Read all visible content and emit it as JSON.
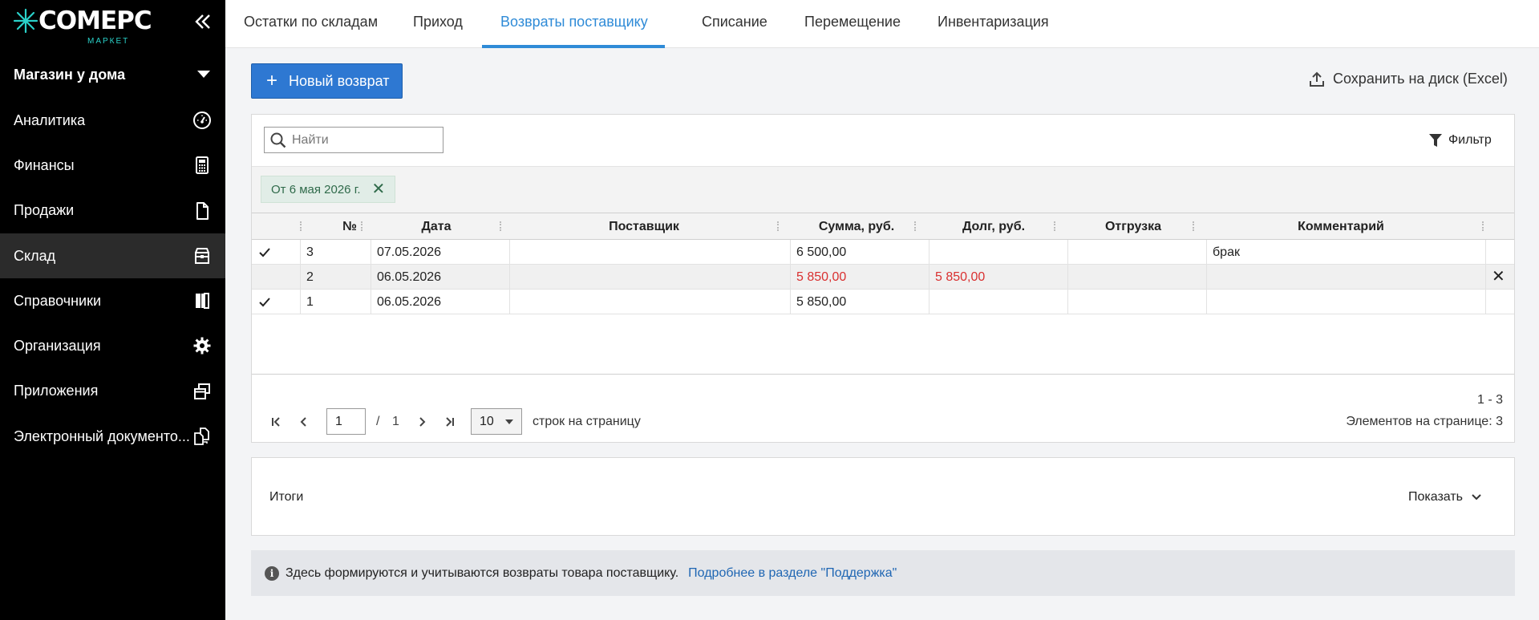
{
  "app": {
    "logo_text": "COMEPC",
    "logo_sub": "МАРКЕТ",
    "store_name": "Магазин у дома"
  },
  "sidebar": {
    "items": [
      {
        "label": "Аналитика",
        "icon": "dashboard-gauge-icon"
      },
      {
        "label": "Финансы",
        "icon": "calculator-icon"
      },
      {
        "label": "Продажи",
        "icon": "document-icon"
      },
      {
        "label": "Склад",
        "icon": "warehouse-box-icon",
        "active": true
      },
      {
        "label": "Справочники",
        "icon": "books-icon"
      },
      {
        "label": "Организация",
        "icon": "gear-icon"
      },
      {
        "label": "Приложения",
        "icon": "windows-icon"
      },
      {
        "label": "Электронный документо...",
        "icon": "doc-exchange-icon"
      }
    ]
  },
  "tabs": [
    {
      "label": "Остатки по складам"
    },
    {
      "label": "Приход"
    },
    {
      "label": "Возвраты поставщику",
      "active": true
    },
    {
      "label": "Списание"
    },
    {
      "label": "Перемещение"
    },
    {
      "label": "Инвентаризация"
    }
  ],
  "toolbar": {
    "new_label": "Новый возврат",
    "save_label": "Сохранить на диск (Excel)"
  },
  "grid": {
    "search_placeholder": "Найти",
    "filter_label": "Фильтр",
    "chip_label": "От 6 мая 2026 г.",
    "columns": [
      "№",
      "Дата",
      "Поставщик",
      "Сумма, руб.",
      "Долг, руб.",
      "Отгрузка",
      "Комментарий"
    ],
    "rows": [
      {
        "checked": true,
        "num": "3",
        "date": "07.05.2026",
        "supplier": "",
        "sum": "6 500,00",
        "debt": "",
        "shipment": "",
        "comment": "брак",
        "red": false
      },
      {
        "checked": false,
        "num": "2",
        "date": "06.05.2026",
        "supplier": "",
        "sum": "5 850,00",
        "debt": "5 850,00",
        "shipment": "",
        "comment": "",
        "red": true
      },
      {
        "checked": true,
        "num": "1",
        "date": "06.05.2026",
        "supplier": "",
        "sum": "5 850,00",
        "debt": "",
        "shipment": "",
        "comment": "",
        "red": false
      }
    ]
  },
  "pager": {
    "page": "1",
    "slash": "/",
    "total_pages": "1",
    "page_size": "10",
    "rows_label": "строк на страницу",
    "range": "1 - 3",
    "count_label": "Элементов на странице: 3"
  },
  "totals": {
    "label": "Итоги",
    "show_label": "Показать"
  },
  "info": {
    "icon": "i",
    "text": "Здесь формируются и учитываются возвраты товара поставщику.",
    "link": "Подробнее в разделе \"Поддержка\""
  },
  "colors": {
    "accent": "#2e78d2",
    "tab_active": "#2f8bd7",
    "debt_red": "#d93030",
    "sidebar_bg": "#000000",
    "logo_teal": "#2ad1c9"
  }
}
